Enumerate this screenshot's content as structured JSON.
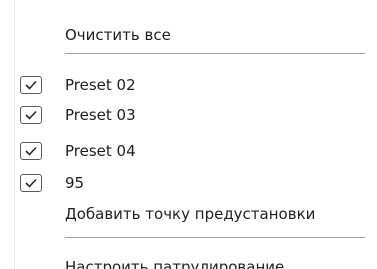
{
  "menu": {
    "clear_all": "Очистить все",
    "presets": [
      {
        "label": "Preset 02",
        "checked": true
      },
      {
        "label": "Preset 03",
        "checked": true
      },
      {
        "label": "Preset 04",
        "checked": true
      },
      {
        "label": "95",
        "checked": true
      }
    ],
    "add_preset": "Добавить точку предустановки",
    "configure_patrol": "Настроить патрулирование"
  }
}
